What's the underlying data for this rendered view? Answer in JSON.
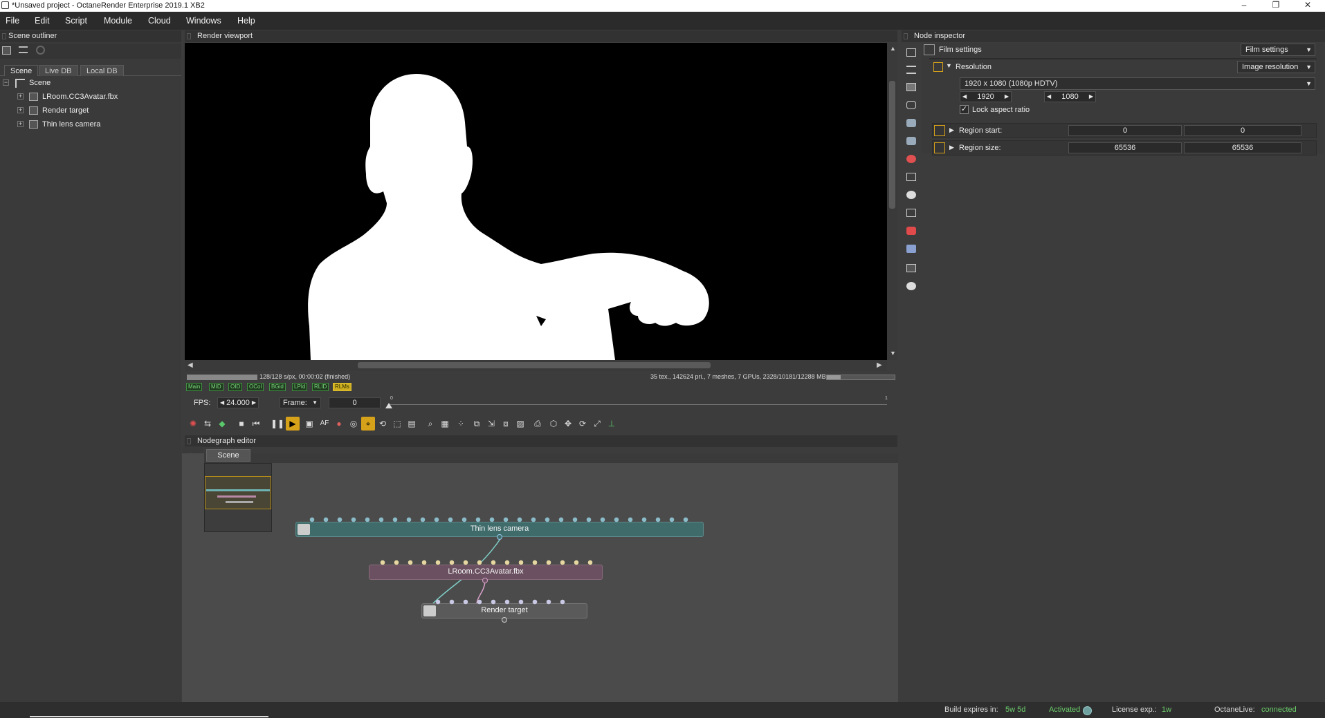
{
  "window": {
    "title": "*Unsaved project - OctaneRender Enterprise 2019.1 XB2",
    "minimize": "–",
    "restore": "❐",
    "close": "✕"
  },
  "menu": [
    "File",
    "Edit",
    "Script",
    "Module",
    "Cloud",
    "Windows",
    "Help"
  ],
  "outliner": {
    "title": "Scene outliner",
    "tabs": [
      "Scene",
      "Live DB",
      "Local DB"
    ],
    "root": "Scene",
    "items": [
      "LRoom.CC3Avatar.fbx",
      "Render target",
      "Thin lens camera"
    ]
  },
  "viewport": {
    "title": "Render viewport",
    "status_left": "128/128 s/px, 00:00:02 (finished)",
    "status_right": "35 tex., 142624 pri., 7 meshes, 7 GPUs, 2328/10181/12288 MB",
    "passes": [
      "Main",
      "MID",
      "OID",
      "OCol",
      "BGid",
      "LPId",
      "RLID",
      "RLMs"
    ],
    "fps_label": "FPS:",
    "fps_value": "24.000",
    "frame_label": "Frame:",
    "frame_value": "0",
    "timeline_start": "0",
    "timeline_end": "1"
  },
  "nodegraph": {
    "title": "Nodegraph editor",
    "tab": "Scene",
    "nodes": {
      "camera": "Thin lens camera",
      "mesh": "LRoom.CC3Avatar.fbx",
      "target": "Render target"
    }
  },
  "inspector": {
    "title": "Node inspector",
    "node_name": "Film settings",
    "node_type": "Film settings",
    "resolution_label": "Resolution",
    "resolution_type": "Image resolution",
    "resolution_preset": "1920 x 1080 (1080p HDTV)",
    "width": "1920",
    "height": "1080",
    "lock_aspect": "Lock aspect ratio",
    "region_start_label": "Region start:",
    "region_start": [
      "0",
      "0"
    ],
    "region_size_label": "Region size:",
    "region_size": [
      "65536",
      "65536"
    ]
  },
  "statusbar": {
    "build_label": "Build expires in:",
    "build_value": "5w 5d",
    "activated": "Activated",
    "license_label": "License exp.:",
    "license_value": "1w",
    "live_label": "OctaneLive:",
    "live_value": "connected"
  },
  "colors": {
    "accent_green": "#7fd67f",
    "camera_node": "#3f6b6b",
    "mesh_node": "#6a5060",
    "target_node": "#5a5a5a",
    "status_green": "#6ccf6c"
  }
}
